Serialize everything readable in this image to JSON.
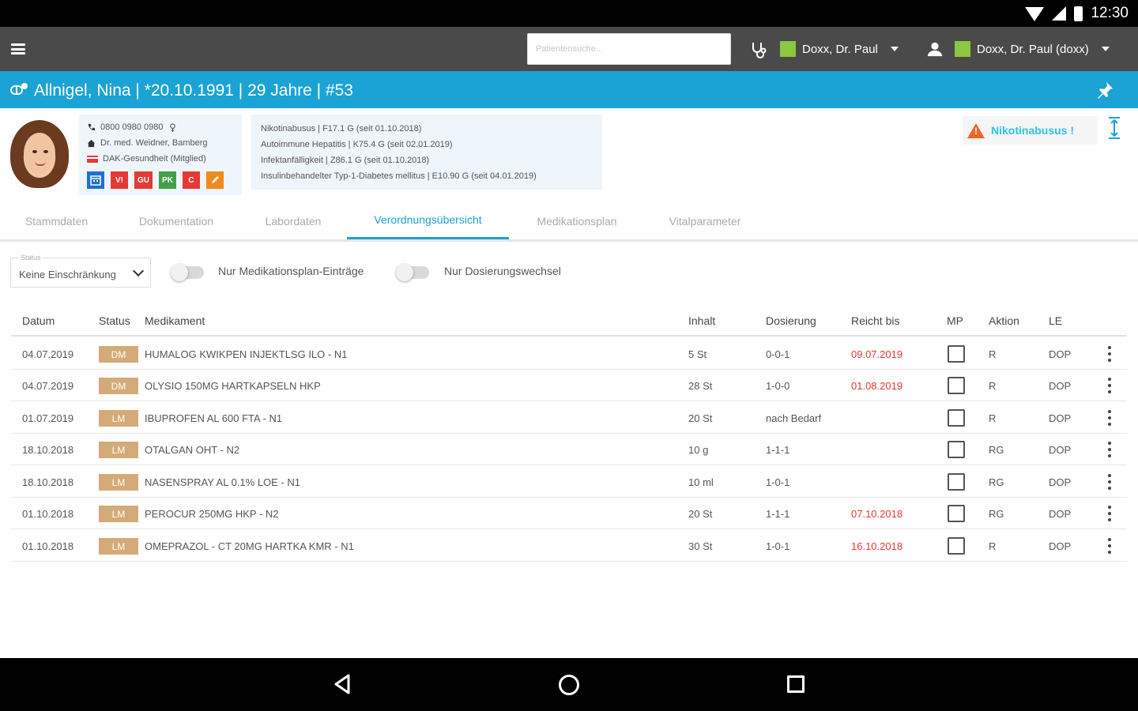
{
  "status_bar": {
    "time": "12:30"
  },
  "app_bar": {
    "search_placeholder": "Patientensuche...",
    "doctor_selector": "Doxx, Dr. Paul",
    "user_selector": "Doxx, Dr. Paul (doxx)"
  },
  "patient": {
    "title": "Allnigel, Nina | *20.10.1991 | 29 Jahre | #53",
    "phone": "0800 0980 0980",
    "doctor": "Dr. med. Weidner, Bamberg",
    "insurance": "DAK-Gesundheit (Mitglied)",
    "badges": [
      {
        "label": "",
        "icon": "calendar-icon",
        "color": "#1e6fd9"
      },
      {
        "label": "V!",
        "color": "#e53935"
      },
      {
        "label": "GU",
        "color": "#e53935"
      },
      {
        "label": "PK",
        "color": "#43a047"
      },
      {
        "label": "C",
        "color": "#e53935"
      },
      {
        "label": "",
        "icon": "edit-icon",
        "color": "#ef8a1e"
      }
    ],
    "diagnoses": [
      "Nikotinabusus | F17.1 G (seit 01.10.2018)",
      "Autoimmune Hepatitis | K75.4 G (seit 02.01.2019)",
      "Infektanfälligkeit | Z86.1 G (seit 01.10.2018)",
      "Insulinbehandelter Typ-1-Diabetes mellitus | E10.90 G (seit 04.01.2019)"
    ],
    "alert": "Nikotinabusus !"
  },
  "tabs": [
    {
      "label": "Stammdaten",
      "active": false
    },
    {
      "label": "Dokumentation",
      "active": false
    },
    {
      "label": "Labordaten",
      "active": false
    },
    {
      "label": "Verordnungsübersicht",
      "active": true
    },
    {
      "label": "Medikationsplan",
      "active": false
    },
    {
      "label": "Vitalparameter",
      "active": false
    }
  ],
  "filters": {
    "status_label": "Status",
    "status_value": "Keine Einschränkung",
    "toggle1_label": "Nur Medikationsplan-Einträge",
    "toggle2_label": "Nur Dosierungswechsel"
  },
  "table": {
    "headers": [
      "Datum",
      "Status",
      "Medikament",
      "Inhalt",
      "Dosierung",
      "Reicht bis",
      "MP",
      "Aktion",
      "LE"
    ],
    "rows": [
      {
        "datum": "04.07.2019",
        "status": "DM",
        "medikament": "HUMALOG KWIKPEN INJEKTLSG ILO - N1",
        "inhalt": "5 St",
        "dosierung": "0-0-1",
        "reicht_bis": "09.07.2019",
        "aktion": "R",
        "le": "DOP"
      },
      {
        "datum": "04.07.2019",
        "status": "DM",
        "medikament": "OLYSIO 150MG HARTKAPSELN HKP",
        "inhalt": "28 St",
        "dosierung": "1-0-0",
        "reicht_bis": "01.08.2019",
        "aktion": "R",
        "le": "DOP"
      },
      {
        "datum": "01.07.2019",
        "status": "LM",
        "medikament": "IBUPROFEN AL 600 FTA - N1",
        "inhalt": "20 St",
        "dosierung": "nach Bedarf",
        "reicht_bis": "",
        "aktion": "R",
        "le": "DOP"
      },
      {
        "datum": "18.10.2018",
        "status": "LM",
        "medikament": "OTALGAN OHT - N2",
        "inhalt": "10 g",
        "dosierung": "1-1-1",
        "reicht_bis": "",
        "aktion": "RG",
        "le": "DOP"
      },
      {
        "datum": "18.10.2018",
        "status": "LM",
        "medikament": "NASENSPRAY AL 0.1% LOE - N1",
        "inhalt": "10 ml",
        "dosierung": "1-0-1",
        "reicht_bis": "",
        "aktion": "RG",
        "le": "DOP"
      },
      {
        "datum": "01.10.2018",
        "status": "LM",
        "medikament": "PEROCUR 250MG HKP - N2",
        "inhalt": "20 St",
        "dosierung": "1-1-1",
        "reicht_bis": "07.10.2018",
        "aktion": "RG",
        "le": "DOP"
      },
      {
        "datum": "01.10.2018",
        "status": "LM",
        "medikament": "OMEPRAZOL - CT 20MG HARTKA KMR - N1",
        "inhalt": "30 St",
        "dosierung": "1-0-1",
        "reicht_bis": "16.10.2018",
        "aktion": "R",
        "le": "DOP"
      }
    ]
  },
  "colors": {
    "accent": "#1aa3d4",
    "appbar": "#4a4a4a",
    "status_chip": "#d4aa78",
    "overdue": "#e53935",
    "alert_text": "#2ec4e6",
    "user_square": "#8dc63f"
  }
}
